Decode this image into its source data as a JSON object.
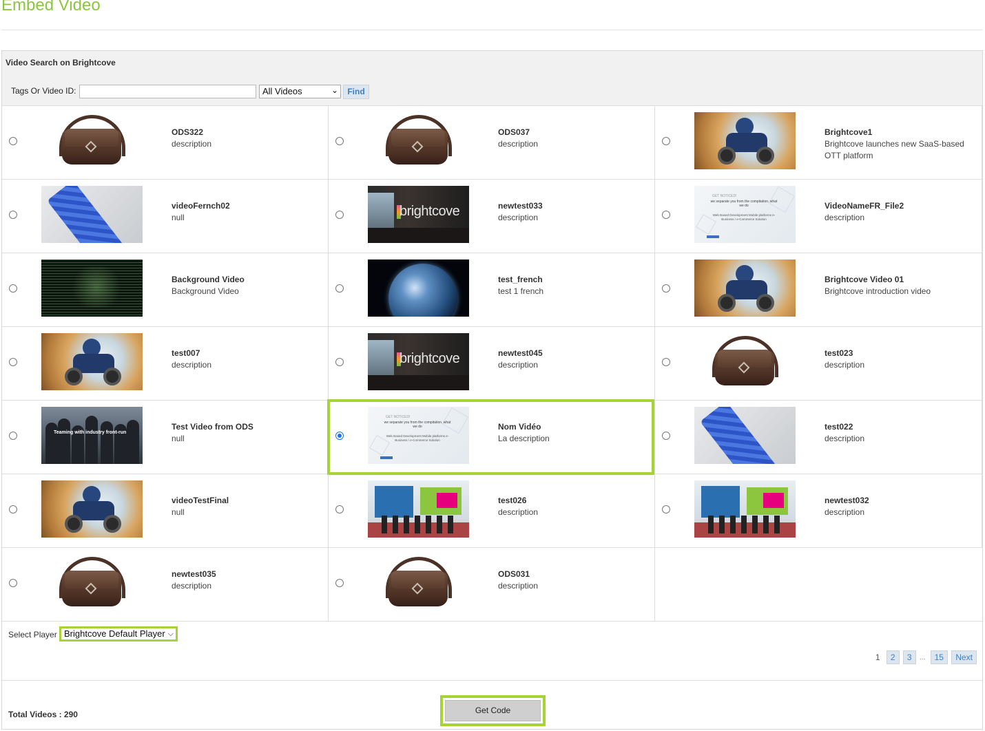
{
  "page": {
    "title": "Embed Video"
  },
  "search": {
    "heading": "Video Search on Brightcove",
    "label": "Tags Or Video ID:",
    "input_value": "",
    "filter_selected": "All Videos",
    "find_label": "Find"
  },
  "videos": [
    {
      "title": "ODS322",
      "description": "description",
      "thumb": "bag",
      "selected": false
    },
    {
      "title": "ODS037",
      "description": "description",
      "thumb": "bag",
      "selected": false
    },
    {
      "title": "Brightcove1",
      "description": "Brightcove launches new SaaS-based OTT platform",
      "thumb": "quad",
      "selected": false
    },
    {
      "title": "videoFernch02",
      "description": "null",
      "thumb": "tie",
      "selected": false
    },
    {
      "title": "newtest033",
      "description": "description",
      "thumb": "brightcove",
      "selected": false
    },
    {
      "title": "VideoNameFR_File2",
      "description": "description",
      "thumb": "slide",
      "selected": false
    },
    {
      "title": "Background Video",
      "description": "Background Video",
      "thumb": "code",
      "selected": false
    },
    {
      "title": "test_french",
      "description": "test 1 french",
      "thumb": "earth",
      "selected": false
    },
    {
      "title": "Brightcove Video 01",
      "description": "Brightcove introduction video",
      "thumb": "quad",
      "selected": false
    },
    {
      "title": "test007",
      "description": "description",
      "thumb": "quad",
      "selected": false
    },
    {
      "title": "newtest045",
      "description": "description",
      "thumb": "brightcove",
      "selected": false
    },
    {
      "title": "test023",
      "description": "description",
      "thumb": "bag",
      "selected": false
    },
    {
      "title": "Test Video from ODS",
      "description": "null",
      "thumb": "people",
      "selected": false
    },
    {
      "title": "Nom Vidéo",
      "description": "La description",
      "thumb": "slide",
      "selected": true
    },
    {
      "title": "test022",
      "description": "description",
      "thumb": "tie",
      "selected": false
    },
    {
      "title": "videoTestFinal",
      "description": "null",
      "thumb": "quad",
      "selected": false
    },
    {
      "title": "test026",
      "description": "description",
      "thumb": "booth",
      "selected": false
    },
    {
      "title": "newtest032",
      "description": "description",
      "thumb": "booth",
      "selected": false
    },
    {
      "title": "newtest035",
      "description": "description",
      "thumb": "bag",
      "selected": false
    },
    {
      "title": "ODS031",
      "description": "description",
      "thumb": "bag",
      "selected": false
    }
  ],
  "thumb_text": {
    "brightcove_logo": "brightcove",
    "slide_notice": "GET NOTICED!",
    "slide_headline": "we separate you from the compitation. what we do",
    "slide_body": "Web Based Development Mobile platforms e-Business / e-Commerce Solution",
    "people_overlay": "Teaming with industry front-run"
  },
  "player": {
    "label": "Select Player",
    "selected": "Brightcove Default Player"
  },
  "pagination": {
    "current": "1",
    "pages": [
      "2",
      "3"
    ],
    "ellipsis": "...",
    "last": "15",
    "next_label": "Next"
  },
  "footer": {
    "total_label": "Total Videos : 290",
    "get_code_label": "Get Code"
  },
  "colors": {
    "accent_green": "#8cc63f",
    "highlight_green": "#a6d435",
    "link_blue": "#3d7fc0",
    "radio_blue": "#1a73e8"
  }
}
